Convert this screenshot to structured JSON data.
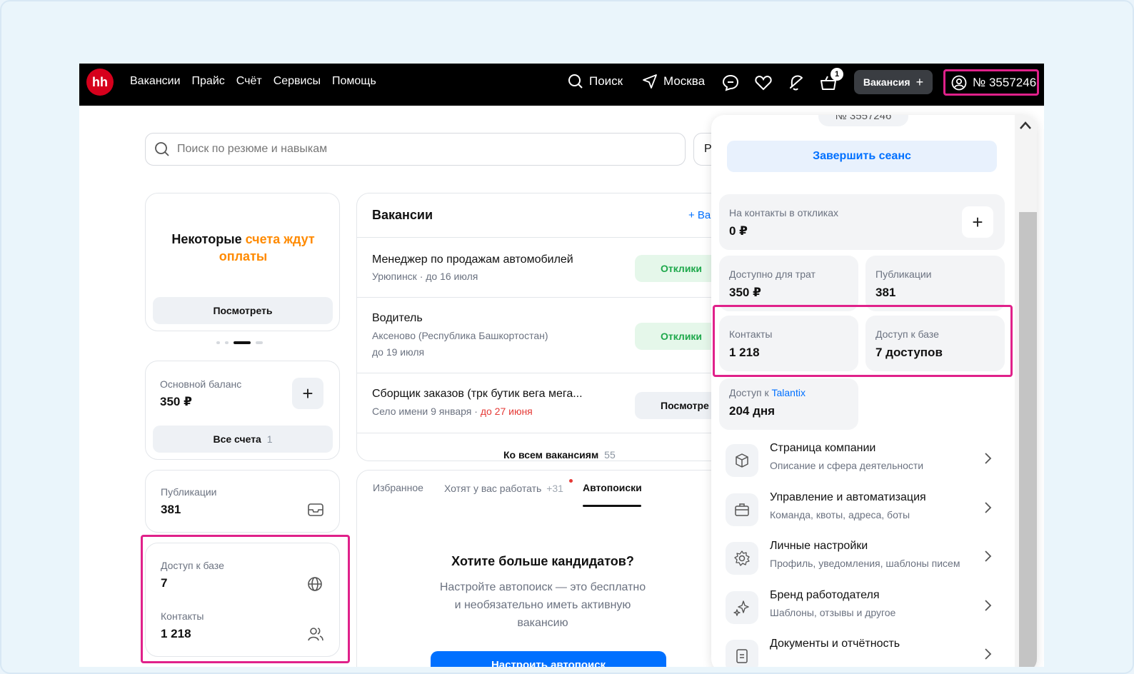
{
  "nav": {
    "logo": "hh",
    "links": [
      "Вакансии",
      "Прайс",
      "Счёт",
      "Сервисы",
      "Помощь"
    ],
    "search_label": "Поиск",
    "city": "Москва",
    "cart_count": "1",
    "vacancy_button": "Вакансия",
    "account_number": "№ 3557246"
  },
  "search": {
    "placeholder": "Поиск по резюме и навыкам",
    "second_field_text": "Р"
  },
  "left": {
    "bills_notice_plain": "Некоторые ",
    "bills_notice_accent": "счета ждут оплаты",
    "view_button": "Посмотреть",
    "balance_label": "Основной баланс",
    "balance_value": "350 ₽",
    "all_accounts_label": "Все счета",
    "all_accounts_count": "1",
    "publications_label": "Публикации",
    "publications_value": "381",
    "db_access_label": "Доступ к базе",
    "db_access_value": "7",
    "contacts_label": "Контакты",
    "contacts_value": "1 218"
  },
  "vacancies": {
    "title": "Вакансии",
    "add_link": "+ Ва",
    "items": [
      {
        "title": "Менеджер по продажам автомобилей",
        "sub": "Урюпинск · до 16 июля",
        "sub2": "",
        "sub_red": "",
        "action": "Отклики"
      },
      {
        "title": "Водитель",
        "sub": "Аксеново (Республика Башкортостан)",
        "sub2": "до 19 июля",
        "sub_red": "",
        "action": "Отклики"
      },
      {
        "title": "Сборщик заказов (трк бутик вега мега...",
        "sub": "Село имени 9 января · ",
        "sub2": "",
        "sub_red": "до 27 июня",
        "action": "Посмотре"
      }
    ],
    "all_link": "Ко всем вакансиям",
    "all_count": "55"
  },
  "tabs": {
    "items": [
      "Избранное",
      "Хотят у вас работать",
      "Автопоиски"
    ],
    "want_count": "+31",
    "active": 2
  },
  "promo": {
    "title": "Хотите больше кандидатов?",
    "text_line1": "Настройте автопоиск — это бесплатно",
    "text_line2": "и необязательно иметь активную",
    "text_line3": "вакансию",
    "button": "Настроить автопоиск"
  },
  "panel": {
    "top_partial": "№ 3557246",
    "end_session": "Завершить сеанс",
    "contacts_in_responses_label": "На контакты в откликах",
    "contacts_in_responses_value": "0 ₽",
    "available_label": "Доступно для трат",
    "available_value": "350 ₽",
    "publications_label": "Публикации",
    "publications_value": "381",
    "contacts_label": "Контакты",
    "contacts_value": "1 218",
    "db_access_label": "Доступ к базе",
    "db_access_value": "7 доступов",
    "talantix_label": "Доступ к ",
    "talantix_link": "Talantix",
    "talantix_value": "204 дня",
    "menu": [
      {
        "title": "Страница компании",
        "sub": "Описание и сфера деятельности",
        "icon": "cube-icon"
      },
      {
        "title": "Управление и автоматизация",
        "sub": "Команда, квоты, адреса, боты",
        "icon": "briefcase-icon"
      },
      {
        "title": "Личные настройки",
        "sub": "Профиль, уведомления, шаблоны писем",
        "icon": "gear-icon"
      },
      {
        "title": "Бренд работодателя",
        "sub": "Шаблоны, отзывы и другое",
        "icon": "sparkle-icon"
      },
      {
        "title": "Документы и отчётность",
        "sub": "",
        "icon": "document-icon"
      }
    ]
  },
  "colors": {
    "accent_orange": "#ff8a00",
    "highlight_pink": "#e0218a",
    "link_blue": "#0070ff",
    "brand_red": "#d6001c"
  }
}
